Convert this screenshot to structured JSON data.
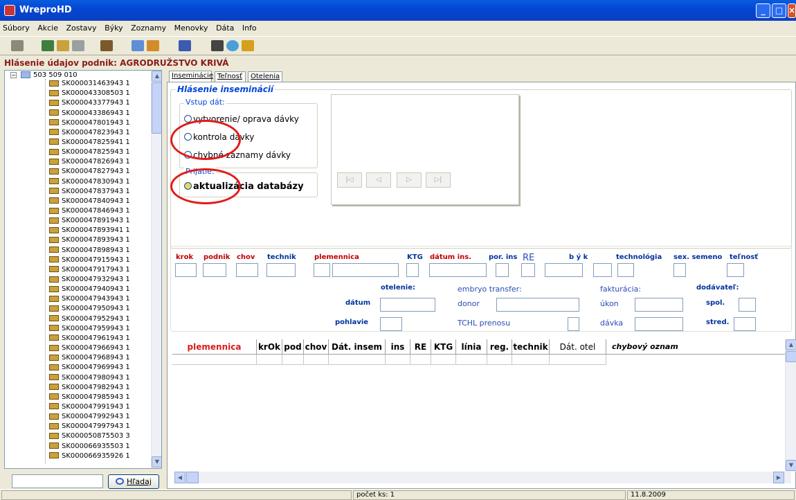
{
  "window": {
    "title": "WreproHD"
  },
  "menu": [
    "Súbory",
    "Akcie",
    "Zostavy",
    "Býky",
    "Zoznamy",
    "Menovky",
    "Dáta",
    "Info"
  ],
  "header": {
    "title": "Hlásenie údajov  podnik: AGRODRUŽSTVO KRIVÁ"
  },
  "tree": {
    "root": "503 509 010",
    "items": [
      "SK000031463943 1",
      "SK000043308503 1",
      "SK000043377943 1",
      "SK000043386943 1",
      "SK000047801943 1",
      "SK000047823943 1",
      "SK000047825941 1",
      "SK000047825943 1",
      "SK000047826943 1",
      "SK000047827943 1",
      "SK000047830943 1",
      "SK000047837943 1",
      "SK000047840943 1",
      "SK000047846943 1",
      "SK000047891943 1",
      "SK000047893941 1",
      "SK000047893943 1",
      "SK000047898943 1",
      "SK000047915943 1",
      "SK000047917943 1",
      "SK000047932943 1",
      "SK000047940943 1",
      "SK000047943943 1",
      "SK000047950943 1",
      "SK000047952943 1",
      "SK000047959943 1",
      "SK000047961943 1",
      "SK000047966943 1",
      "SK000047968943 1",
      "SK000047969943 1",
      "SK000047980943 1",
      "SK000047982943 1",
      "SK000047985943 1",
      "SK000047991943 1",
      "SK000047992943 1",
      "SK000047997943 1",
      "SK000050875503 3",
      "SK000066935503 1",
      "SK000066935926 1"
    ]
  },
  "search": {
    "value": "",
    "button": "Hľadaj"
  },
  "tabs": [
    "Inseminácie",
    "Teľnosť",
    "Otelenia"
  ],
  "form": {
    "title": "Hlásenie inseminácií",
    "input_group": "Vstup dát:",
    "options": [
      "vytvorenie/ oprava dávky",
      "kontrola dávky",
      "chybné záznamy dávky"
    ],
    "accept_group": "Prijatie:",
    "accept_option": "aktualizácia databázy",
    "nav": [
      "|◁",
      "◁",
      "▷",
      "▷|"
    ]
  },
  "fields": {
    "krok": "krok",
    "podnik": "podnik",
    "chov": "chov",
    "technik": "technik",
    "plemennica": "plemennica",
    "ktg": "KTG",
    "datum_ins": "dátum ins.",
    "por_ins": "por. ins",
    "re": "RE",
    "byk": "b ý k",
    "technologia": "technológia",
    "sex_semeno": "sex. semeno",
    "telnost": "teľnosť",
    "otelenie": "otelenie:",
    "datum": "dátum",
    "pohlavie": "pohlavie",
    "embryo": "embryo transfer:",
    "donor": "donor",
    "tchl": "TCHL prenosu",
    "fakturacia": "fakturácia:",
    "ukon": "úkon",
    "davka": "dávka",
    "dodavatel": "dodávateľ:",
    "spol": "spol.",
    "stred": "stred."
  },
  "grid": {
    "columns": [
      "plemennica",
      "krOk",
      "pod",
      "chov",
      "Dát. insem",
      "ins",
      "RE",
      "KTG",
      "línia",
      "reg.",
      "technik",
      "Dát. otel",
      "chybový oznam"
    ]
  },
  "status": {
    "count": "počet ks:  1",
    "date": "11.8.2009"
  }
}
